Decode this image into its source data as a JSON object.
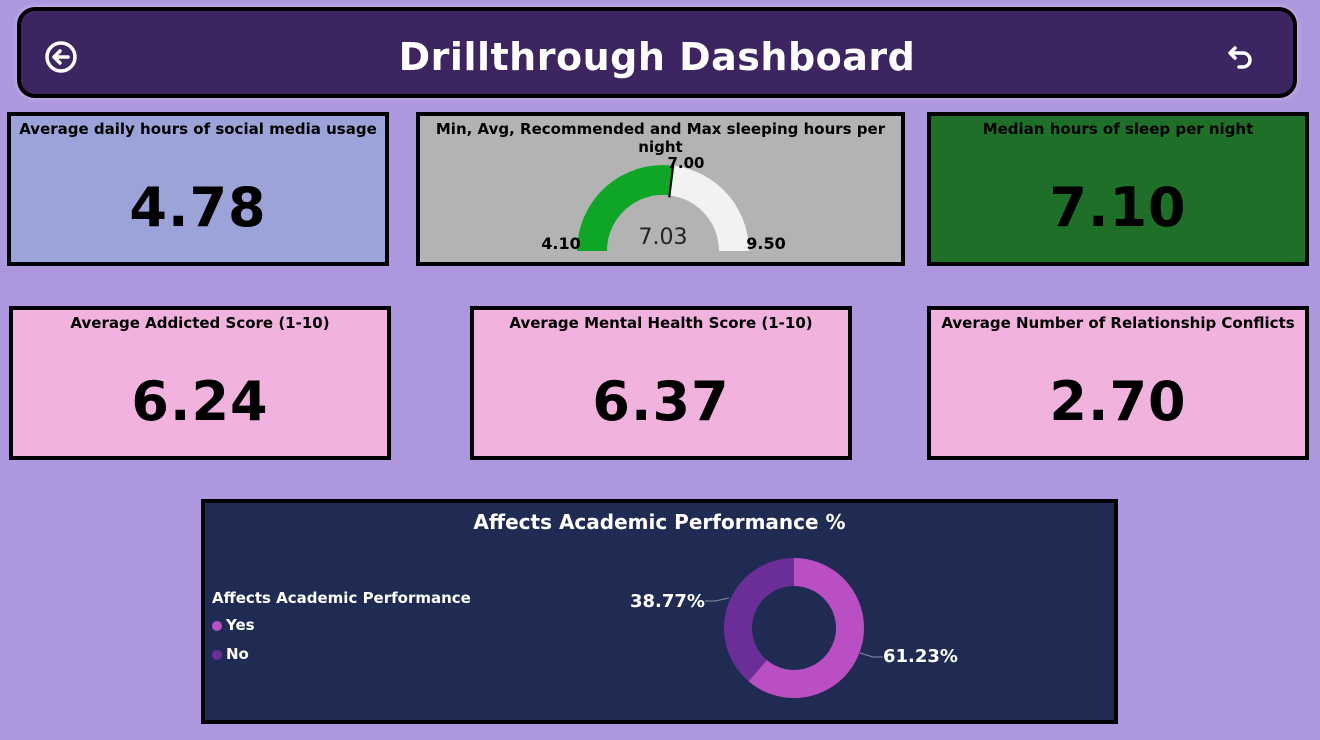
{
  "header": {
    "title": "Drillthrough Dashboard",
    "back_icon": "circle-arrow-left-icon",
    "reset_icon": "undo-arrow-icon"
  },
  "cards": {
    "social_media": {
      "title": "Average daily hours of social media usage",
      "value": "4.78",
      "color": "#9ca3d8"
    },
    "sleep_gauge": {
      "title": "Min, Avg, Recommended and Max sleeping hours per night",
      "min_label": "4.10",
      "max_label": "9.50",
      "target_label": "7.00",
      "value_label": "7.03",
      "min": 4.1,
      "max": 9.5,
      "target": 7.0,
      "value": 7.03,
      "color": "#b3b3b3",
      "fill_color": "#0fa527",
      "track_color": "#f2f2f2"
    },
    "median_sleep": {
      "title": "Median hours of sleep per night",
      "value": "7.10",
      "color": "#1e7028"
    },
    "addicted": {
      "title": "Average Addicted Score (1-10)",
      "value": "6.24",
      "color": "#f1b2de"
    },
    "mental_health": {
      "title": "Average Mental Health Score (1-10)",
      "value": "6.37",
      "color": "#f1b2de"
    },
    "conflicts": {
      "title": "Average Number of Relationship Conflicts",
      "value": "2.70",
      "color": "#f1b2de"
    }
  },
  "donut": {
    "title": "Affects Academic Performance %",
    "legend_title": "Affects Academic Performance",
    "label_yes": "61.23%",
    "label_no": "38.77%",
    "colors": {
      "yes": "#b94fc3",
      "no": "#6b2e99"
    }
  },
  "chart_data": {
    "type": "pie",
    "title": "Affects Academic Performance %",
    "categories": [
      "Yes",
      "No"
    ],
    "values": [
      61.23,
      38.77
    ]
  }
}
